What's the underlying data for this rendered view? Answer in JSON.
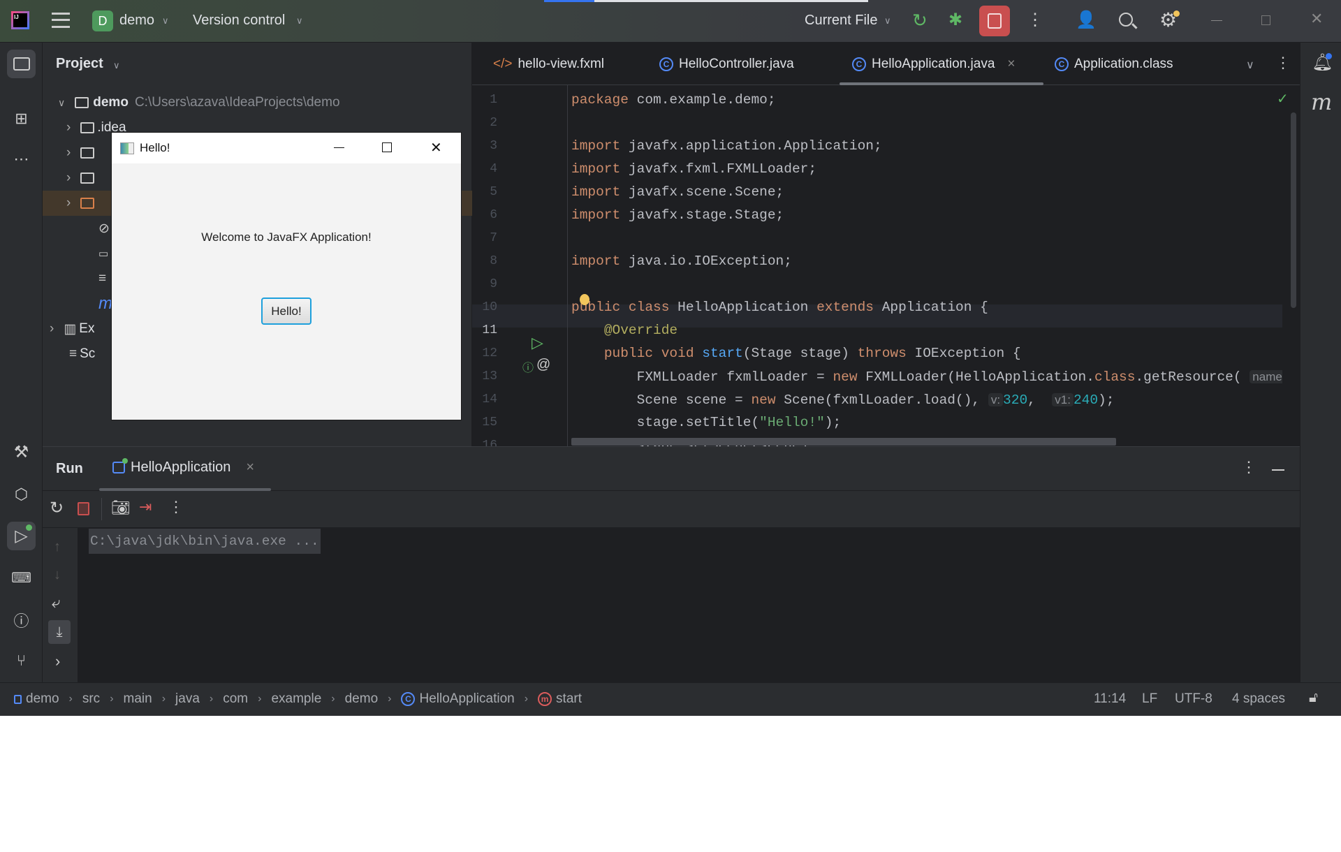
{
  "titlebar": {
    "project_initial": "D",
    "project_name": "demo",
    "vcs_label": "Version control",
    "run_config": "Current File"
  },
  "project_panel": {
    "title": "Project",
    "root": {
      "name": "demo",
      "path": "C:\\Users\\azava\\IdeaProjects\\demo"
    },
    "items": [
      {
        "label": ".idea"
      },
      {
        "label": "Ex"
      },
      {
        "label": "Sc"
      }
    ]
  },
  "editor": {
    "tabs": [
      {
        "label": "hello-view.fxml",
        "icon": "xml-icon"
      },
      {
        "label": "HelloController.java",
        "icon": "class-icon"
      },
      {
        "label": "HelloApplication.java",
        "icon": "class-icon",
        "active": true,
        "close": "×"
      },
      {
        "label": "Application.class",
        "icon": "class-icon"
      }
    ],
    "current_line": 11,
    "lines": [
      [
        [
          "package",
          "kw"
        ],
        [
          " com.example.demo;",
          ""
        ]
      ],
      [],
      [
        [
          "import",
          "kw"
        ],
        [
          " javafx.application.Application;",
          ""
        ]
      ],
      [
        [
          "import",
          "kw"
        ],
        [
          " javafx.fxml.FXMLLoader;",
          ""
        ]
      ],
      [
        [
          "import",
          "kw"
        ],
        [
          " javafx.scene.Scene;",
          ""
        ]
      ],
      [
        [
          "import",
          "kw"
        ],
        [
          " javafx.stage.Stage;",
          ""
        ]
      ],
      [],
      [
        [
          "import",
          "kw"
        ],
        [
          " java.io.IOException;",
          ""
        ]
      ],
      [],
      [
        [
          "public class",
          "kw"
        ],
        [
          " HelloApplication ",
          ""
        ],
        [
          "extends",
          "kw"
        ],
        [
          " Application {",
          ""
        ]
      ],
      [
        [
          "    ",
          ""
        ],
        [
          "@Override",
          "ann"
        ]
      ],
      [
        [
          "    ",
          ""
        ],
        [
          "public void",
          "kw"
        ],
        [
          " ",
          ""
        ],
        [
          "start",
          "fn"
        ],
        [
          "(Stage stage) ",
          ""
        ],
        [
          "throws",
          "kw"
        ],
        [
          " IOException {",
          ""
        ]
      ],
      [
        [
          "        FXMLLoader fxmlLoader = ",
          ""
        ],
        [
          "new",
          "kw"
        ],
        [
          " FXMLLoader(HelloApplication.",
          ""
        ],
        [
          "class",
          "kw"
        ],
        [
          ".getResource( ",
          ""
        ],
        [
          "name",
          "hint"
        ]
      ],
      [
        [
          "        Scene scene = ",
          ""
        ],
        [
          "new",
          "kw"
        ],
        [
          " Scene(fxmlLoader.load(), ",
          ""
        ],
        [
          "v:",
          "hint"
        ],
        [
          "320",
          "num"
        ],
        [
          ",  ",
          ""
        ],
        [
          "v1:",
          "hint"
        ],
        [
          "240",
          "num"
        ],
        [
          ");",
          ""
        ]
      ],
      [
        [
          "        stage.setTitle(",
          ""
        ],
        [
          "\"Hello!\"",
          "str"
        ],
        [
          ");",
          ""
        ]
      ],
      [
        [
          "        stage.setScene(scene);",
          ""
        ]
      ]
    ]
  },
  "run_panel": {
    "title": "Run",
    "tab_label": "HelloApplication",
    "tab_close": "×",
    "console_text": "C:\\java\\jdk\\bin\\java.exe ..."
  },
  "hello_window": {
    "title": "Hello!",
    "message": "Welcome to JavaFX Application!",
    "button": "Hello!"
  },
  "statusbar": {
    "breadcrumbs": [
      "demo",
      "src",
      "main",
      "java",
      "com",
      "example",
      "demo",
      "HelloApplication",
      "start"
    ],
    "position": "11:14",
    "line_ending": "LF",
    "encoding": "UTF-8",
    "indent": "4 spaces"
  },
  "colors": {
    "accent": "#3574f0",
    "stop_button": "#c94f4f",
    "run_green": "#5fb865",
    "keyword": "#cf8e6d"
  }
}
